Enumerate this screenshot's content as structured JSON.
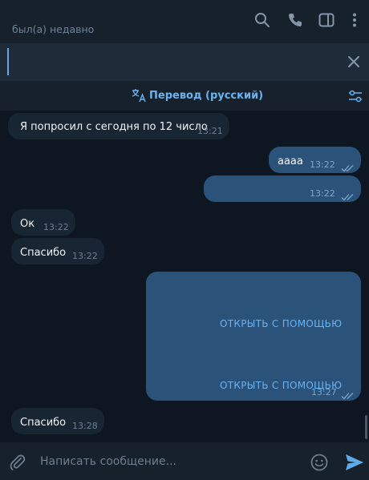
{
  "header": {
    "status": "был(а) недавно",
    "icons": [
      "search-icon",
      "phone-icon",
      "sidebar-toggle-icon",
      "more-vertical-icon"
    ]
  },
  "search": {
    "value": ""
  },
  "translate": {
    "label": "Перевод (русский)"
  },
  "messages": [
    {
      "dir": "in",
      "text": "Я попросил с сегодня по 12 число",
      "time": "13:21"
    },
    {
      "dir": "out",
      "text": "аааа",
      "time": "13:22",
      "read": true
    },
    {
      "dir": "out",
      "text": "",
      "time": "13:22",
      "read": true
    },
    {
      "dir": "in",
      "text": "Ок",
      "time": "13:22"
    },
    {
      "dir": "in",
      "text": "Спасибо",
      "time": "13:22"
    },
    {
      "dir": "out",
      "text": "",
      "time": "13:27",
      "read": true,
      "buttons": [
        "ОТКРЫТЬ С ПОМОЩЬЮ",
        "ОТКРЫТЬ С ПОМОЩЬЮ"
      ]
    },
    {
      "dir": "in",
      "text": "Спасибо",
      "time": "13:28"
    }
  ],
  "composer": {
    "placeholder": "Написать сообщение..."
  },
  "colors": {
    "background": "#0e1621",
    "panel": "#17212b",
    "incoming": "#182533",
    "outgoing": "#2b5278",
    "accent": "#6ab3f3"
  }
}
